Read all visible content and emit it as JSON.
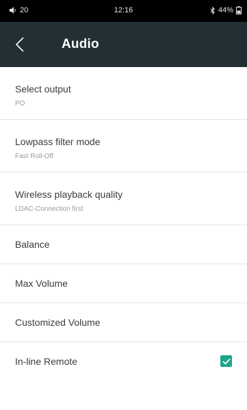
{
  "status_bar": {
    "volume": "20",
    "time": "12:16",
    "battery": "44%"
  },
  "header": {
    "title": "Audio"
  },
  "settings": [
    {
      "title": "Select output",
      "subtitle": "PO"
    },
    {
      "title": "Lowpass filter mode",
      "subtitle": "Fast Roll-Off"
    },
    {
      "title": "Wireless playback quality",
      "subtitle": "LDAC-Connection first"
    },
    {
      "title": "Balance"
    },
    {
      "title": "Max Volume"
    },
    {
      "title": "Customized Volume"
    },
    {
      "title": "In-line Remote",
      "checked": true
    }
  ],
  "colors": {
    "header_bg": "#223036",
    "accent": "#1fa58a"
  }
}
